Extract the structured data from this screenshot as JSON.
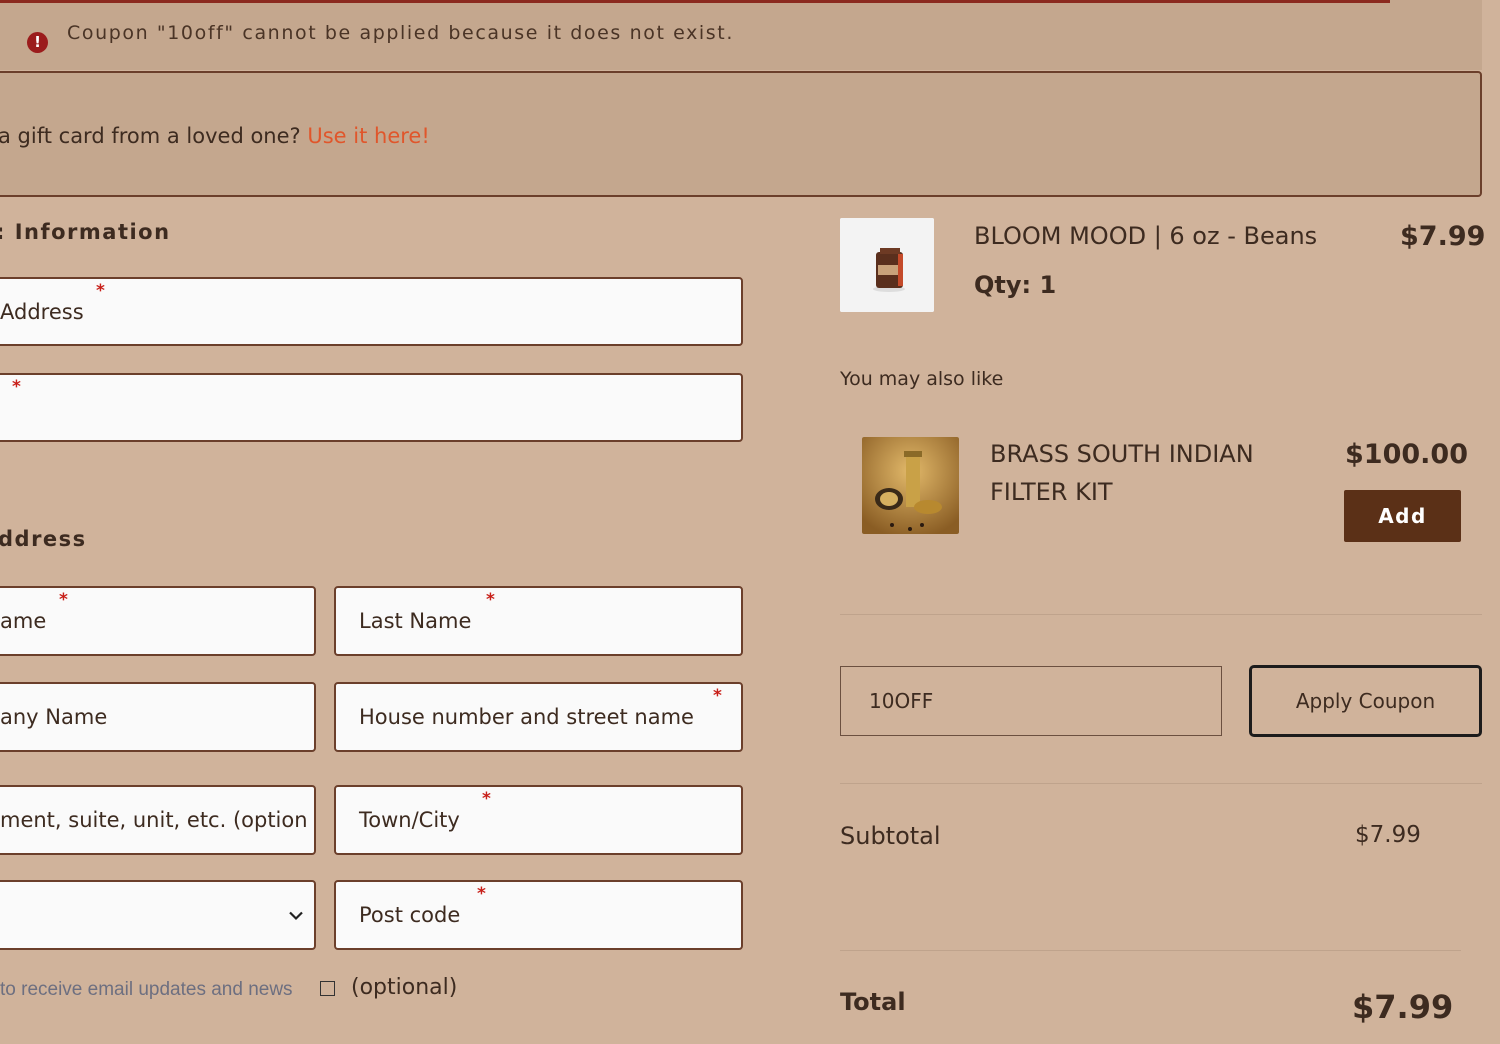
{
  "notice": {
    "icon": "error-icon",
    "message": "Coupon \"10off\" cannot be applied because it does not exist."
  },
  "gift_card": {
    "text": "a gift card from a loved one?",
    "link": "Use it here!"
  },
  "contact": {
    "title": ": Information",
    "email_label": "Address",
    "phone_label": ""
  },
  "shipping": {
    "title": "ddress",
    "first_name_label": "ame",
    "last_name_label": "Last Name",
    "company_label": "any Name",
    "street_label": "House number and street name",
    "apartment_label": "ment, suite, unit, etc. (option",
    "city_label": "Town/City",
    "country_value": "",
    "postcode_label": "Post code"
  },
  "newsletter": {
    "text": "to receive email updates and news",
    "optional": "(optional)"
  },
  "cart_item": {
    "name": "BLOOM MOOD | 6 oz - Beans",
    "qty": "Qty: 1",
    "price": "$7.99"
  },
  "upsell": {
    "title": "You may also like",
    "name_line1": "BRASS SOUTH INDIAN",
    "name_line2": "FILTER KIT",
    "price": "$100.00",
    "add_label": "Add"
  },
  "coupon": {
    "value": "10OFF",
    "apply_label": "Apply Coupon"
  },
  "totals": {
    "subtotal_label": "Subtotal",
    "subtotal_value": "$7.99",
    "total_label": "Total",
    "total_value": "$7.99"
  },
  "colors": {
    "background": "#d0b39b",
    "accent_link": "#e0562b",
    "button_dark": "#5b3017",
    "error": "#9b1c1c"
  }
}
